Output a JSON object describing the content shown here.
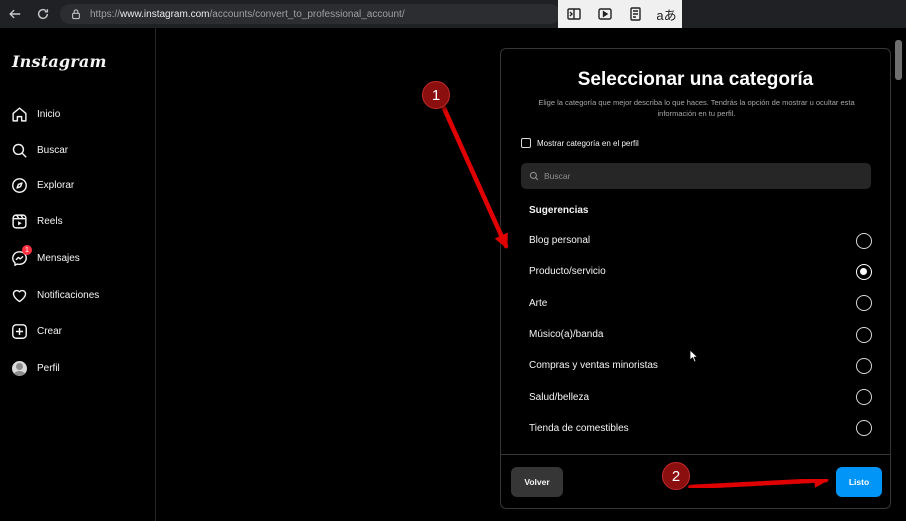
{
  "browser": {
    "url_prefix": "https://",
    "url_domain": "www.instagram.com",
    "url_path": "/accounts/convert_to_professional_account/"
  },
  "sidebar": {
    "logo": "Instagram",
    "items": [
      {
        "label": "Inicio",
        "icon": "home-icon"
      },
      {
        "label": "Buscar",
        "icon": "search-icon"
      },
      {
        "label": "Explorar",
        "icon": "compass-icon"
      },
      {
        "label": "Reels",
        "icon": "reels-icon"
      },
      {
        "label": "Mensajes",
        "icon": "messenger-icon",
        "badge": "1"
      },
      {
        "label": "Notificaciones",
        "icon": "heart-icon"
      },
      {
        "label": "Crear",
        "icon": "plus-square-icon"
      },
      {
        "label": "Perfil",
        "icon": "avatar"
      }
    ]
  },
  "modal": {
    "title": "Seleccionar una categoría",
    "subtitle": "Elige la categoría que mejor describa lo que haces. Tendrás la opción de mostrar u ocultar esta información en tu perfil.",
    "checkbox_label": "Mostrar categoría en el perfil",
    "checkbox_checked": false,
    "search_placeholder": "Buscar",
    "section_label": "Sugerencias",
    "categories": [
      {
        "label": "Blog personal",
        "selected": false
      },
      {
        "label": "Producto/servicio",
        "selected": true
      },
      {
        "label": "Arte",
        "selected": false
      },
      {
        "label": "Músico(a)/banda",
        "selected": false
      },
      {
        "label": "Compras y ventas minoristas",
        "selected": false
      },
      {
        "label": "Salud/belleza",
        "selected": false
      },
      {
        "label": "Tienda de comestibles",
        "selected": false
      }
    ],
    "back_label": "Volver",
    "done_label": "Listo",
    "done_color": "#0095f6"
  },
  "annotations": {
    "step1": "1",
    "step2": "2",
    "arrow_color": "#e00000"
  }
}
